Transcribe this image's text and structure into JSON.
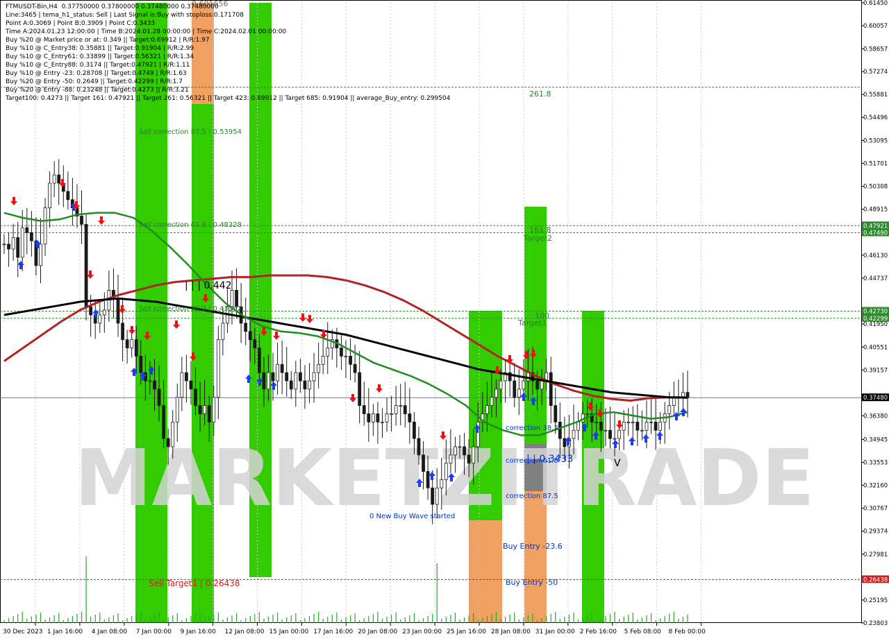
{
  "header": {
    "symbol_line": "FTMUSDT-Bin,H4  0.37750000 0.37800000 0.37480000 0.37480000",
    "lines": [
      "Line:3465 | tema_h1_status: Sell | Last Signal is:Buy with stoploss:0.171708",
      "Point A:0.3069 | Point B:0.3909 | Point C:0.3433",
      "Time A:2024.01.23 12:00:00 | Time B:2024.01.28 00:00:00 | Time C:2024.02.01 00:00:00",
      "Buy %20 @ Market price or at: 0.349 || Target:0.69912 | R/R:1.97",
      "Buy %10 @ C_Entry38: 0.35881 || Target:0.91904 | R/R:2.99",
      "Buy %10 @ C_Entry61: 0.33899 || Target:0.56321 | R/R:1.34",
      "Buy %10 @ C_Entry88: 0.3174 || Target:0.47921 | R/R:1.11",
      "Buy %10 @ Entry -23: 0.28708 || Target:0.4749 | R/R:1.63",
      "Buy %20 @ Entry -50: 0.2649 || Target:0.42299 | R/R:1.7",
      "Buy %20 @ Entry -88: 0.23248 || Target:0.4273 || R/R:3.21",
      "Target100: 0.4273 || Target 161: 0.47921 || Target 261: 0.56321 || Target 423: 0.69912 || Target 685: 0.91904 || average_Buy_entry: 0.299504"
    ],
    "top_cut_label": "0.601656"
  },
  "colors": {
    "bg": "#ffffff",
    "bull": "#1a1a1a",
    "green_zone": "#33cc00",
    "orange_zone": "#f0a060",
    "gray_zone": "#808080",
    "ma_black": "#000000",
    "ma_red": "#b22222",
    "ma_green": "#1e8c1e",
    "level_green": "#2e8b2e",
    "level_red": "#cc2222",
    "watermark": "#d0d0d0"
  },
  "chart_data": {
    "type": "line",
    "title": "FTMUSDT-Bin,H4",
    "ylim": [
      0.23803,
      0.6145
    ],
    "y_ticks": [
      "0.61450",
      "0.60057",
      "0.58657",
      "0.57274",
      "0.55881",
      "0.54496",
      "0.53095",
      "0.51701",
      "0.50308",
      "0.48915",
      "0.47921",
      "0.47490",
      "0.46130",
      "0.44737",
      "0.42730",
      "0.42299",
      "0.41950",
      "0.40551",
      "0.39157",
      "0.37480",
      "0.36380",
      "0.34945",
      "0.33553",
      "0.32160",
      "0.30767",
      "0.29374",
      "0.27981",
      "0.26438",
      "0.25195",
      "0.23803"
    ],
    "y_tick_values": [
      0.6145,
      0.60057,
      0.58657,
      0.57274,
      0.55881,
      0.54496,
      0.53095,
      0.51701,
      0.50308,
      0.48915,
      0.47921,
      0.4749,
      0.4613,
      0.44737,
      0.4273,
      0.42299,
      0.4195,
      0.40551,
      0.39157,
      0.3748,
      0.3638,
      0.34945,
      0.33553,
      0.3216,
      0.30767,
      0.29374,
      0.27981,
      0.26438,
      0.25195,
      0.23803
    ],
    "highlight_ticks": {
      "green": [
        "0.56321",
        "0.47921",
        "0.47490",
        "0.42730",
        "0.42299"
      ],
      "red": [
        "0.26438"
      ],
      "current": "0.37480"
    },
    "x_ticks": [
      "30 Dec 2023",
      "1 Jan 16:00",
      "4 Jan 08:00",
      "7 Jan 00:00",
      "9 Jan 16:00",
      "12 Jan 08:00",
      "15 Jan 00:00",
      "17 Jan 16:00",
      "20 Jan 08:00",
      "23 Jan 00:00",
      "25 Jan 16:00",
      "28 Jan 08:00",
      "31 Jan 00:00",
      "2 Feb 16:00",
      "5 Feb 08:00",
      "8 Feb 00:00"
    ],
    "close": [
      0.468,
      0.465,
      0.472,
      0.46,
      0.478,
      0.475,
      0.47,
      0.455,
      0.468,
      0.49,
      0.505,
      0.51,
      0.505,
      0.5,
      0.495,
      0.49,
      0.485,
      0.48,
      0.43,
      0.425,
      0.42,
      0.425,
      0.428,
      0.44,
      0.435,
      0.42,
      0.41,
      0.405,
      0.41,
      0.4,
      0.39,
      0.385,
      0.385,
      0.38,
      0.37,
      0.35,
      0.345,
      0.36,
      0.375,
      0.39,
      0.385,
      0.38,
      0.37,
      0.365,
      0.37,
      0.36,
      0.375,
      0.41,
      0.42,
      0.43,
      0.44,
      0.43,
      0.42,
      0.415,
      0.41,
      0.405,
      0.39,
      0.38,
      0.39,
      0.385,
      0.395,
      0.39,
      0.385,
      0.38,
      0.39,
      0.385,
      0.38,
      0.385,
      0.39,
      0.395,
      0.4,
      0.405,
      0.41,
      0.405,
      0.4,
      0.4,
      0.395,
      0.39,
      0.37,
      0.365,
      0.36,
      0.365,
      0.36,
      0.36,
      0.365,
      0.365,
      0.37,
      0.37,
      0.365,
      0.36,
      0.35,
      0.34,
      0.33,
      0.32,
      0.31,
      0.32,
      0.325,
      0.335,
      0.34,
      0.345,
      0.345,
      0.34,
      0.335,
      0.345,
      0.36,
      0.365,
      0.37,
      0.375,
      0.38,
      0.385,
      0.39,
      0.385,
      0.375,
      0.38,
      0.385,
      0.39,
      0.385,
      0.38,
      0.385,
      0.39,
      0.37,
      0.36,
      0.35,
      0.345,
      0.35,
      0.355,
      0.36,
      0.365,
      0.365,
      0.36,
      0.36,
      0.355,
      0.355,
      0.35,
      0.35,
      0.355,
      0.36,
      0.36,
      0.36,
      0.355,
      0.355,
      0.36,
      0.36,
      0.355,
      0.36,
      0.365,
      0.37,
      0.375,
      0.375,
      0.378,
      0.3748
    ],
    "ma_black": [
      0.425,
      0.427,
      0.429,
      0.431,
      0.433,
      0.434,
      0.435,
      0.434,
      0.433,
      0.431,
      0.429,
      0.427,
      0.425,
      0.423,
      0.421,
      0.419,
      0.417,
      0.415,
      0.413,
      0.41,
      0.407,
      0.404,
      0.401,
      0.398,
      0.395,
      0.392,
      0.39,
      0.388,
      0.386,
      0.384,
      0.382,
      0.38,
      0.378,
      0.377,
      0.376,
      0.375,
      0.3748
    ],
    "ma_red": [
      0.397,
      0.405,
      0.413,
      0.421,
      0.428,
      0.433,
      0.437,
      0.44,
      0.443,
      0.445,
      0.446,
      0.447,
      0.448,
      0.448,
      0.449,
      0.449,
      0.449,
      0.448,
      0.446,
      0.443,
      0.439,
      0.434,
      0.428,
      0.421,
      0.414,
      0.407,
      0.4,
      0.394,
      0.388,
      0.383,
      0.379,
      0.376,
      0.374,
      0.373,
      0.3745,
      0.375,
      0.375
    ],
    "ma_green": [
      0.487,
      0.484,
      0.482,
      0.483,
      0.486,
      0.487,
      0.487,
      0.484,
      0.476,
      0.466,
      0.455,
      0.443,
      0.432,
      0.424,
      0.418,
      0.415,
      0.414,
      0.412,
      0.408,
      0.402,
      0.396,
      0.392,
      0.388,
      0.383,
      0.377,
      0.37,
      0.36,
      0.355,
      0.352,
      0.352,
      0.356,
      0.36,
      0.365,
      0.366,
      0.364,
      0.362,
      0.363,
      0.366
    ],
    "levels": [
      {
        "value": 0.56321,
        "label": "261.8",
        "color": "green"
      },
      {
        "value": 0.47921,
        "label": "161.8",
        "color": "green"
      },
      {
        "value": 0.4749,
        "label": "Target2",
        "color": "green"
      },
      {
        "value": 0.4273,
        "label": "100",
        "color": "green"
      },
      {
        "value": 0.42299,
        "label": "Target1",
        "color": "green"
      },
      {
        "value": 0.26438,
        "label": "Sell Target1 | 0.26438",
        "color": "red"
      },
      {
        "value": 0.3748,
        "label": "",
        "color": "blue"
      }
    ],
    "annotations": [
      "Sell correction 87.5 | 0.53954",
      "Sell correction 61.8 | 0.48328",
      "Sell correction 38.2 | 0.43162",
      "| | | 0.442",
      "0 New Buy Wave started",
      "correction 38.2",
      "correction 61.8",
      "correction 87.5",
      "Buy Entry -23.6",
      "Buy Entry -50",
      "| | 0.3433",
      "V"
    ],
    "watermark": "MARKETZITRADE"
  }
}
